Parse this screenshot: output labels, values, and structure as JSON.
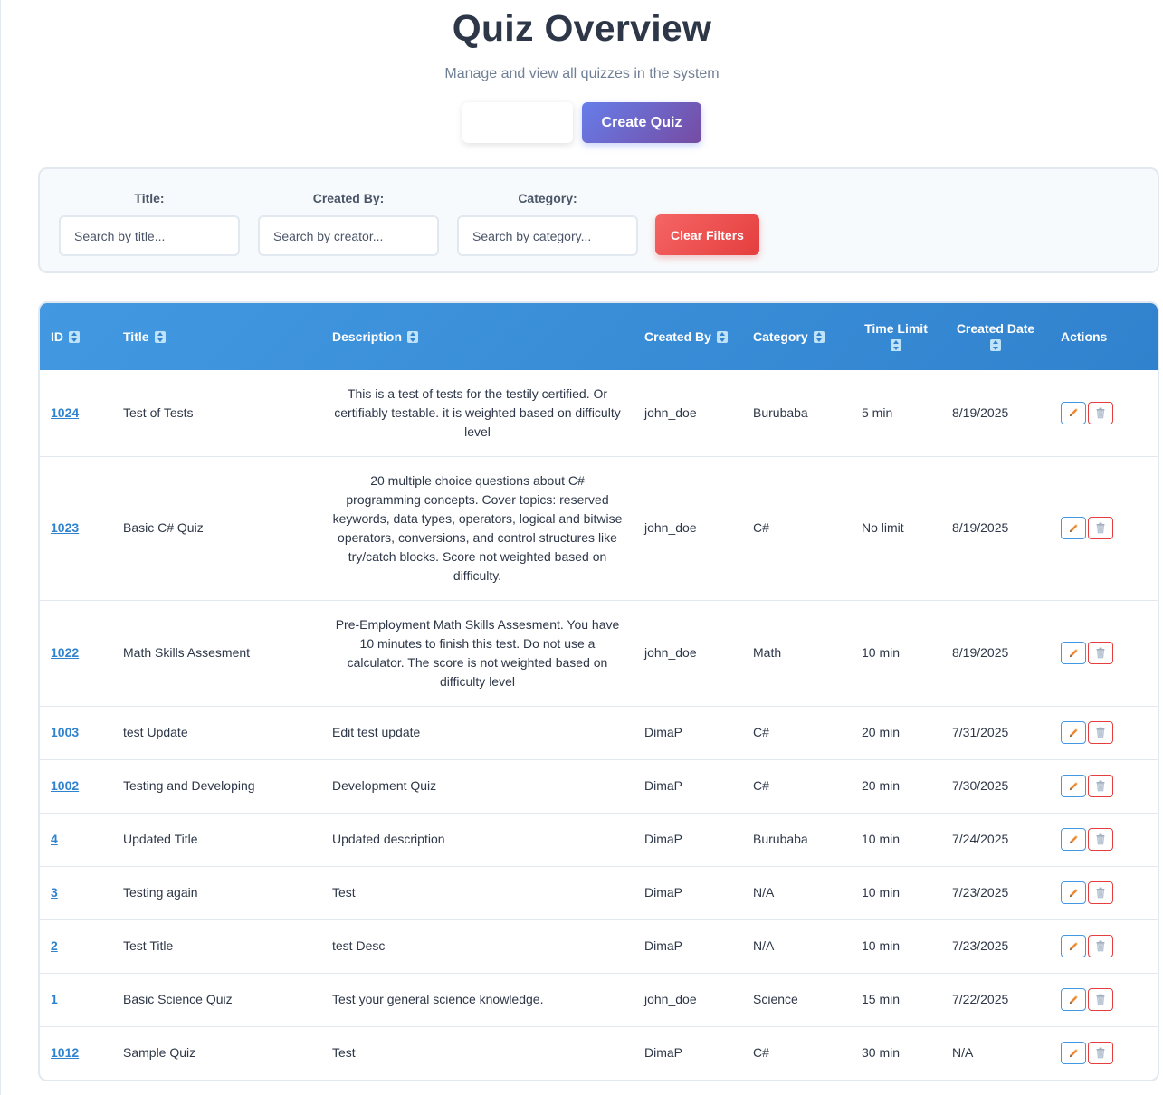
{
  "header": {
    "title": "Quiz Overview",
    "subtitle": "Manage and view all quizzes in the system",
    "create_label": "Create Quiz"
  },
  "filters": {
    "title_label": "Title:",
    "title_placeholder": "Search by title...",
    "creator_label": "Created By:",
    "creator_placeholder": "Search by creator...",
    "category_label": "Category:",
    "category_placeholder": "Search by category...",
    "clear_label": "Clear Filters"
  },
  "table": {
    "columns": {
      "id": "ID",
      "title": "Title",
      "description": "Description",
      "created_by": "Created By",
      "category": "Category",
      "time_limit": "Time Limit",
      "created_date": "Created Date",
      "actions": "Actions"
    },
    "rows": [
      {
        "id": "1024",
        "title": "Test of Tests",
        "description": "This is a test of tests for the testily certified. Or certifiably testable. it is weighted based on difficulty level",
        "created_by": "john_doe",
        "category": "Burubaba",
        "time_limit": "5 min",
        "created_date": "8/19/2025"
      },
      {
        "id": "1023",
        "title": "Basic C# Quiz",
        "description": "20 multiple choice questions about C# programming concepts. Cover topics: reserved keywords, data types, operators, logical and bitwise operators, conversions, and control structures like try/catch blocks. Score not weighted based on difficulty.",
        "created_by": "john_doe",
        "category": "C#",
        "time_limit": "No limit",
        "created_date": "8/19/2025"
      },
      {
        "id": "1022",
        "title": "Math Skills Assesment",
        "description": "Pre-Employment Math Skills Assesment. You have 10 minutes to finish this test. Do not use a calculator. The score is not weighted based on difficulty level",
        "created_by": "john_doe",
        "category": "Math",
        "time_limit": "10 min",
        "created_date": "8/19/2025"
      },
      {
        "id": "1003",
        "title": "test Update",
        "description": "Edit test update",
        "created_by": "DimaP",
        "category": "C#",
        "time_limit": "20 min",
        "created_date": "7/31/2025"
      },
      {
        "id": "1002",
        "title": "Testing and Developing",
        "description": "Development Quiz",
        "created_by": "DimaP",
        "category": "C#",
        "time_limit": "20 min",
        "created_date": "7/30/2025"
      },
      {
        "id": "4",
        "title": "Updated Title",
        "description": "Updated description",
        "created_by": "DimaP",
        "category": "Burubaba",
        "time_limit": "10 min",
        "created_date": "7/24/2025"
      },
      {
        "id": "3",
        "title": "Testing again",
        "description": "Test",
        "created_by": "DimaP",
        "category": "N/A",
        "time_limit": "10 min",
        "created_date": "7/23/2025"
      },
      {
        "id": "2",
        "title": "Test Title",
        "description": "test Desc",
        "created_by": "DimaP",
        "category": "N/A",
        "time_limit": "10 min",
        "created_date": "7/23/2025"
      },
      {
        "id": "1",
        "title": "Basic Science Quiz",
        "description": "Test your general science knowledge.",
        "created_by": "john_doe",
        "category": "Science",
        "time_limit": "15 min",
        "created_date": "7/22/2025"
      },
      {
        "id": "1012",
        "title": "Sample Quiz",
        "description": "Test",
        "created_by": "DimaP",
        "category": "C#",
        "time_limit": "30 min",
        "created_date": "N/A"
      }
    ]
  },
  "colors": {
    "header_gradient_start": "#4299e1",
    "header_gradient_end": "#3182ce",
    "create_gradient_start": "#667eea",
    "create_gradient_end": "#764ba2",
    "clear_color": "#e53e3e",
    "link_color": "#3182ce"
  },
  "icons": {
    "edit": "pencil-icon",
    "delete": "trash-icon",
    "sort": "sort-icon"
  }
}
